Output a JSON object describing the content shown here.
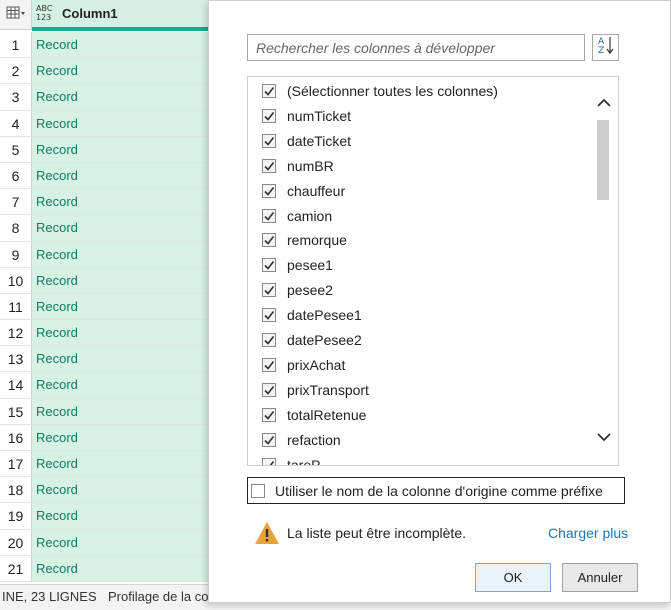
{
  "grid": {
    "type_label_top": "ABC",
    "type_label_bottom": "123",
    "column_name": "Column1",
    "rows": [
      {
        "num": "1",
        "value": "Record"
      },
      {
        "num": "2",
        "value": "Record"
      },
      {
        "num": "3",
        "value": "Record"
      },
      {
        "num": "4",
        "value": "Record"
      },
      {
        "num": "5",
        "value": "Record"
      },
      {
        "num": "6",
        "value": "Record"
      },
      {
        "num": "7",
        "value": "Record"
      },
      {
        "num": "8",
        "value": "Record"
      },
      {
        "num": "9",
        "value": "Record"
      },
      {
        "num": "10",
        "value": "Record"
      },
      {
        "num": "11",
        "value": "Record"
      },
      {
        "num": "12",
        "value": "Record"
      },
      {
        "num": "13",
        "value": "Record"
      },
      {
        "num": "14",
        "value": "Record"
      },
      {
        "num": "15",
        "value": "Record"
      },
      {
        "num": "16",
        "value": "Record"
      },
      {
        "num": "17",
        "value": "Record"
      },
      {
        "num": "18",
        "value": "Record"
      },
      {
        "num": "19",
        "value": "Record"
      },
      {
        "num": "20",
        "value": "Record"
      },
      {
        "num": "21",
        "value": "Record"
      }
    ]
  },
  "status_bar": {
    "summary": "INE, 23 LIGNES",
    "profiling": "Profilage de la co"
  },
  "popup": {
    "search_placeholder": "Rechercher les colonnes à développer",
    "columns": [
      {
        "label": "(Sélectionner toutes les colonnes)",
        "checked": true
      },
      {
        "label": "numTicket",
        "checked": true
      },
      {
        "label": "dateTicket",
        "checked": true
      },
      {
        "label": "numBR",
        "checked": true
      },
      {
        "label": "chauffeur",
        "checked": true
      },
      {
        "label": "camion",
        "checked": true
      },
      {
        "label": "remorque",
        "checked": true
      },
      {
        "label": "pesee1",
        "checked": true
      },
      {
        "label": "pesee2",
        "checked": true
      },
      {
        "label": "datePesee1",
        "checked": true
      },
      {
        "label": "datePesee2",
        "checked": true
      },
      {
        "label": "prixAchat",
        "checked": true
      },
      {
        "label": "prixTransport",
        "checked": true
      },
      {
        "label": "totalRetenue",
        "checked": true
      },
      {
        "label": "refaction",
        "checked": true
      },
      {
        "label": "tareP",
        "checked": true
      }
    ],
    "prefix_option": {
      "label": "Utiliser le nom de la colonne d'origine comme préfixe",
      "checked": false
    },
    "warning_text": "La liste peut être incomplète.",
    "load_more": "Charger plus",
    "ok_label": "OK",
    "cancel_label": "Annuler"
  },
  "colors": {
    "accent": "#1ca890",
    "cell_bg": "#d8f1e5",
    "record_text": "#107c61",
    "link": "#1f75b5",
    "warning": "#e8a33d"
  },
  "icons": {
    "table_menu": "table-icon",
    "expand": "expand-columns-icon",
    "sort": "sort-az-icon",
    "checkbox": "check-icon",
    "warning": "warning-icon",
    "scroll_up": "chevron-up-icon",
    "scroll_down": "chevron-down-icon"
  }
}
